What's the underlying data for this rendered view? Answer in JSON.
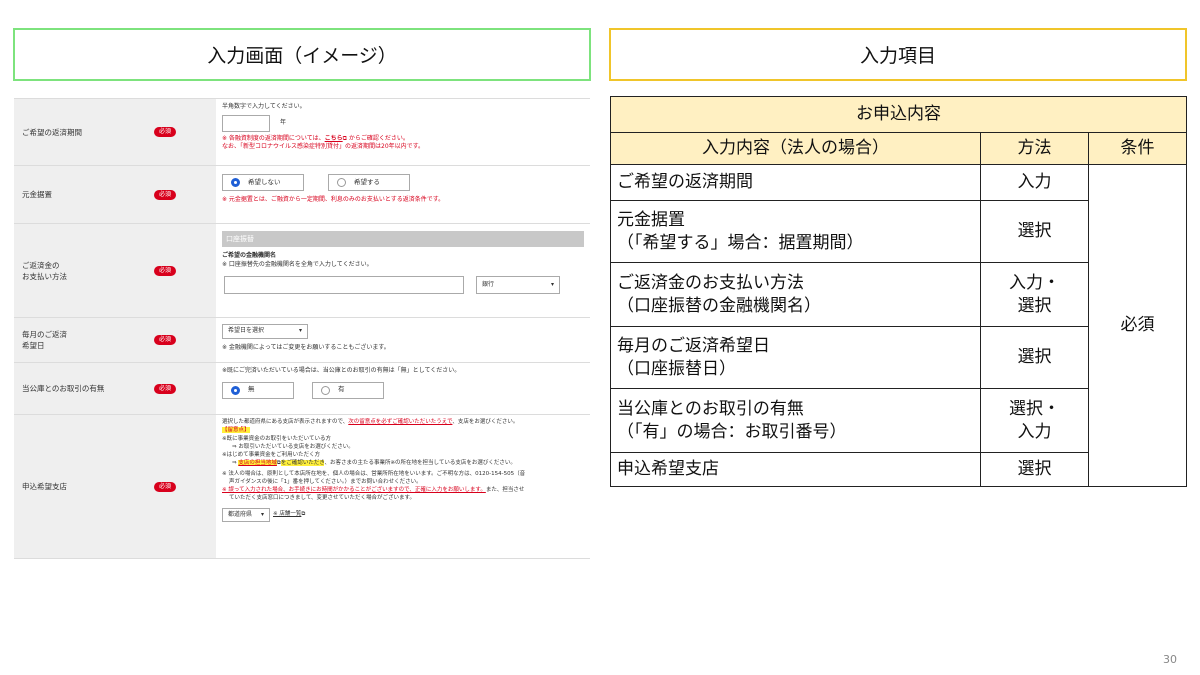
{
  "headers": {
    "left": "入力画面（イメージ）",
    "right": "入力項目"
  },
  "form": {
    "required_badge": "必須",
    "row1": {
      "label": "ご希望の返済期間",
      "hint": "半角数字で入力してください。",
      "unit": "年",
      "note1_a": "※ 各融資制度の返済期間については、",
      "note1_link": "こちら",
      "note1_b": " からご確認ください。",
      "note2": "なお、「新型コロナウイルス感染症特別貸付」の返済期間は20年以内です。"
    },
    "row2": {
      "label": "元金据置",
      "opt_no": "希望しない",
      "opt_yes": "希望する",
      "note": "※ 元金据置とは、ご融資から一定期間、利息のみのお支払いとする返済条件です。"
    },
    "row3": {
      "label1": "ご返済金の",
      "label2": "お支払い方法",
      "bar": "口座振替",
      "title": "ご希望の金融機関名",
      "note": "※ 口座振替先の金融機関名を全角で入力してください。",
      "select": "銀行"
    },
    "row4": {
      "label1": "毎月のご返済",
      "label2": "希望日",
      "select": "希望日を選択",
      "note": "※ 金融機関によってはご変更をお願いすることもございます。"
    },
    "row5": {
      "label": "当公庫とのお取引の有無",
      "note": "※既にご完済いただいている場合は、当公庫とのお取引の有無は「無」としてください。",
      "opt_no": "無",
      "opt_yes": "有"
    },
    "row6": {
      "label": "申込希望支店",
      "l1_a": "選択した都道府県にある支店が表示されますので、",
      "l1_link": "次の留意点を必ずご確認いただいたうえで",
      "l1_b": "、支店をお選びください。",
      "l2": "【留意点】",
      "l3": "※既に事業資金のお取引をいただいている方",
      "l4": "⇒ お取引いただいている支店をお選びください。",
      "l5": "※はじめて事業資金をご利用いただく方",
      "l6_arrow": "⇒ ",
      "l6_link": "支店の担当地域",
      "l6_hl": "をご確認いただき",
      "l6_b": "、お客さまの主たる事業所※の所在地を担当している支店をお選びください。",
      "l7": "※ 法人の場合は、原則として本店所在地を、個人の場合は、営業所所在地をいいます。ご不明な方は、0120-154-505（音",
      "l8": "声ガイダンスの後に「1」番を押してください。）までお問い合わせください。",
      "l9_link": "※ 誤って入力された場合、お手続きにお時間がかかることがございますので、正確に入力をお願いします。",
      "l9_b": "また、担当させ",
      "l10": "ていただく支店窓口につきまして、変更させていただく場合がございます。",
      "select": "都道府県",
      "store": "※ 店舗一覧"
    }
  },
  "table": {
    "title": "お申込内容",
    "columns": [
      "入力内容（法人の場合）",
      "方法",
      "条件"
    ],
    "rows": [
      {
        "item": [
          "ご希望の返済期間"
        ],
        "method": [
          "入力"
        ]
      },
      {
        "item": [
          "元金据置",
          "（「希望する」場合：据置期間）"
        ],
        "method": [
          "選択"
        ]
      },
      {
        "item": [
          "ご返済金のお支払い方法",
          "（口座振替の金融機関名）"
        ],
        "method": [
          "入力・",
          "選択"
        ]
      },
      {
        "item": [
          "毎月のご返済希望日",
          "（口座振替日）"
        ],
        "method": [
          "選択"
        ]
      },
      {
        "item": [
          "当公庫とのお取引の有無",
          "（「有」の場合：お取引番号）"
        ],
        "method": [
          "選択・",
          "入力"
        ]
      },
      {
        "item": [
          "申込希望支店"
        ],
        "method": [
          "選択"
        ]
      }
    ],
    "condition": "必須"
  },
  "page_number": "30",
  "colors": {
    "left_border": "#7de37d",
    "right_border": "#f0c52a",
    "badge": "#d8001c",
    "title_green": "#13a313",
    "table_header_bg": "#fff0c2"
  }
}
